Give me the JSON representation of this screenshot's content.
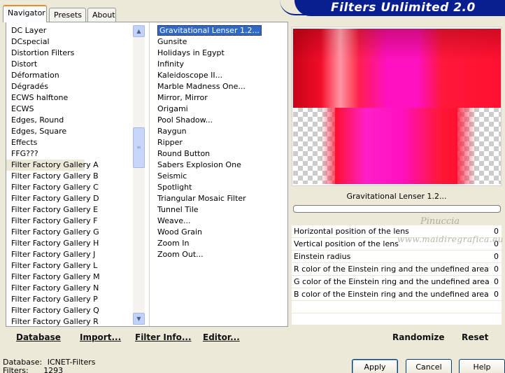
{
  "tabs": [
    "Navigator",
    "Presets",
    "About"
  ],
  "banner_title": "Filters Unlimited 2.0",
  "categories": [
    "DC Layer",
    "DCspecial",
    "Distortion Filters",
    "Distort",
    "Déformation",
    "Dégradés",
    "ECWS halftone",
    "ECWS",
    "Edges, Round",
    "Edges, Square",
    "Effects",
    "FFG???",
    "Filter Factory Gallery A",
    "Filter Factory Gallery B",
    "Filter Factory Gallery C",
    "Filter Factory Gallery D",
    "Filter Factory Gallery E",
    "Filter Factory Gallery F",
    "Filter Factory Gallery G",
    "Filter Factory Gallery H",
    "Filter Factory Gallery J",
    "Filter Factory Gallery L",
    "Filter Factory Gallery M",
    "Filter Factory Gallery N",
    "Filter Factory Gallery P",
    "Filter Factory Gallery Q",
    "Filter Factory Gallery R"
  ],
  "selected_category": "Filter Factory Gallery A",
  "filters": [
    "Gravitational Lenser 1.2...",
    "Gunsite",
    "Holidays in Egypt",
    "Infinity",
    "Kaleidoscope II...",
    "Marble Madness One...",
    "Mirror, Mirror",
    "Origami",
    "Pool Shadow...",
    "Raygun",
    "Ripper",
    "Round Button",
    "Sabers Explosion One",
    "Seismic",
    "Spotlight",
    "Triangular Mosaic Filter",
    "Tunnel Tile",
    "Weave...",
    "Wood Grain",
    "Zoom In",
    "Zoom Out..."
  ],
  "selected_filter": "Gravitational Lenser 1.2...",
  "preview_filter_name": "Gravitational Lenser 1.2...",
  "params": [
    {
      "label": "Horizontal position of the lens",
      "value": "0"
    },
    {
      "label": "Vertical position of the lens",
      "value": "0"
    },
    {
      "label": "Einstein radius",
      "value": "0"
    },
    {
      "label": "R color of the Einstein ring and the undefined area",
      "value": "0"
    },
    {
      "label": "G color of the Einstein ring and the undefined area",
      "value": "0"
    },
    {
      "label": "B color of the Einstein ring and the undefined area",
      "value": "0"
    }
  ],
  "watermark": {
    "line1": "Pinuccia",
    "line2": "www.maidiregrafica.eu"
  },
  "left_actions": {
    "database": "Database",
    "import": "Import...",
    "filter_info": "Filter Info...",
    "editor": "Editor..."
  },
  "right_actions": {
    "randomize": "Randomize",
    "reset": "Reset"
  },
  "info": {
    "database_label": "Database:",
    "database_value": "ICNET-Filters",
    "filters_label": "Filters:",
    "filters_value": "1293"
  },
  "buttons": {
    "apply": "Apply",
    "cancel": "Cancel",
    "help": "Help"
  },
  "colors": {
    "selection": "#316ac5",
    "banner": "#0a1f8f",
    "preview_red": "#ff0a2e",
    "preview_magenta": "#ff1ec8"
  }
}
